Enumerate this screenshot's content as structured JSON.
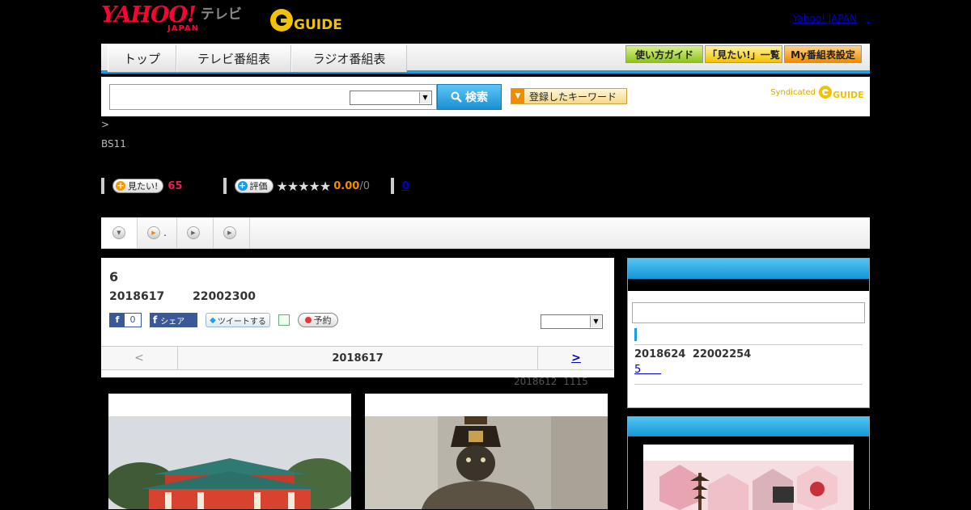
{
  "header": {
    "logo_text": "YAHOO!",
    "logo_sub": "JAPAN",
    "logo_tv": "テレビ",
    "gguide_text": "GUIDE",
    "yahoo_japan_link": "Yahoo! JAPAN",
    "extra_link": ","
  },
  "nav": {
    "tabs": [
      "トップ",
      "テレビ番組表",
      "ラジオ番組表"
    ],
    "buttons": [
      "使い方ガイド",
      "「見たい!」一覧",
      "My番組表設定"
    ]
  },
  "search": {
    "placeholder": "",
    "button_label": "検索",
    "keyword_button": "登録したキーワード",
    "syndicated": "Syndicated"
  },
  "breadcrumb": ">",
  "station": "BS11",
  "rating": {
    "want_label": "見たい!",
    "want_count": "65",
    "rate_label": "評価",
    "stars": "★★★★★",
    "score": "0.00",
    "score_max": "/0",
    "comments": "0"
  },
  "subtabs": [
    ".",
    "",
    ""
  ],
  "program": {
    "title": "6",
    "datetime": "2018617 22002300",
    "fb_count": "0",
    "fb_share": "シェア",
    "tweet": "ツイートする",
    "record": "予約",
    "pager_prev": "<",
    "pager_date": "2018617",
    "pager_next": ">",
    "updated": "2018612 1115"
  },
  "sidebar": {
    "next_datetime": "2018624 22002254",
    "next_link": "5      "
  },
  "colors": {
    "accent_blue": "#1a9ee0",
    "yahoo_red": "#ff0033",
    "want_red": "#e0205a",
    "score_orange": "#f08c00"
  }
}
